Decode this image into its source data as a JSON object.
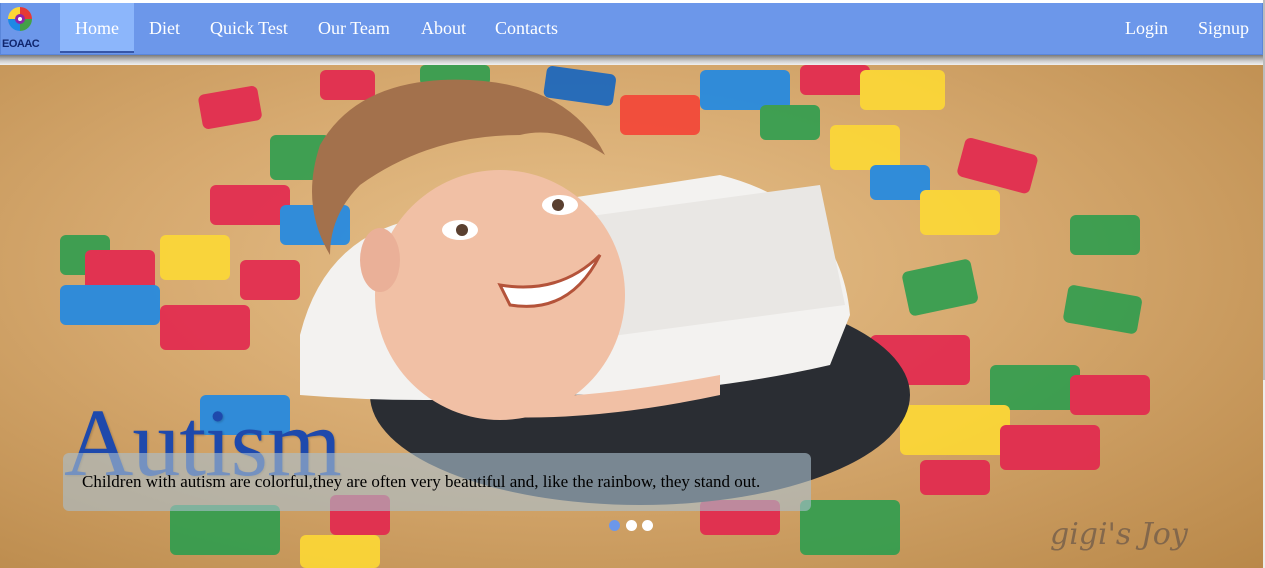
{
  "brand": {
    "logo_text": "EOAAC"
  },
  "nav": {
    "items": [
      {
        "label": "Home"
      },
      {
        "label": "Diet"
      },
      {
        "label": "Quick Test"
      },
      {
        "label": "Our Team"
      },
      {
        "label": "About"
      },
      {
        "label": "Contacts"
      }
    ],
    "active": "Home",
    "login": "Login",
    "signup": "Signup"
  },
  "hero": {
    "title": "Autism",
    "caption": "Children with autism are colorful,they are often very beautiful and, like the rainbow, they stand out.",
    "signature": "gigi's Joy",
    "slide_indicators": 3,
    "active_slide": 1
  },
  "colors": {
    "navbar": "#6c97ea",
    "nav_active": "#8cb6fb",
    "title": "#1e49ac"
  }
}
